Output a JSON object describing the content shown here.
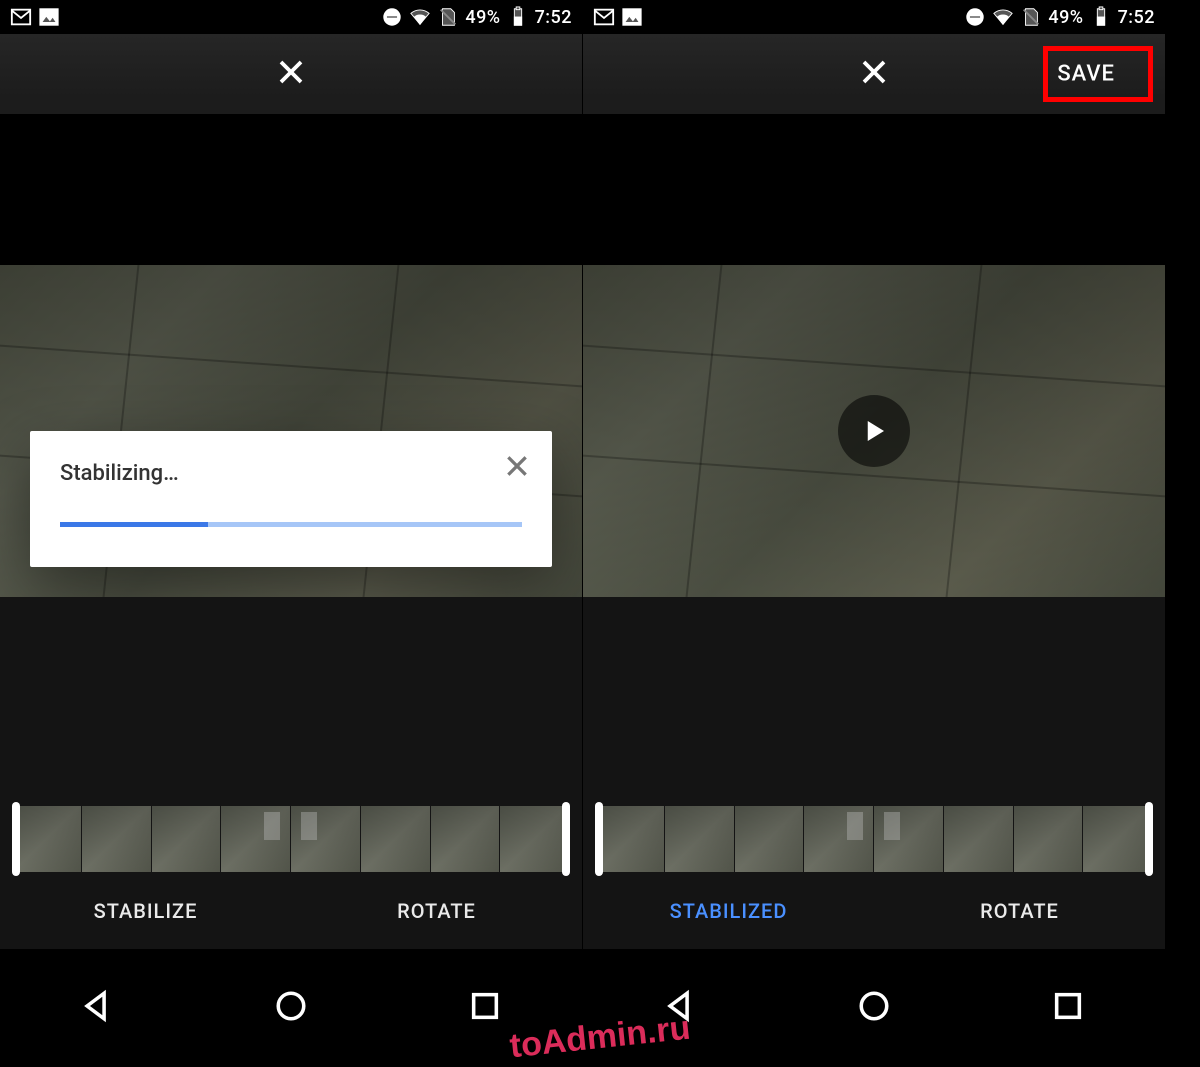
{
  "status": {
    "battery_pct": "49%",
    "time": "7:52"
  },
  "appbar": {
    "save_label": "SAVE"
  },
  "dialog": {
    "title": "Stabilizing…",
    "progress_pct": 32
  },
  "bottom": {
    "left_screen": {
      "primary": "STABILIZE",
      "secondary": "ROTATE"
    },
    "right_screen": {
      "primary": "STABILIZED",
      "secondary": "ROTATE"
    }
  },
  "watermark": "toAdmin.ru"
}
